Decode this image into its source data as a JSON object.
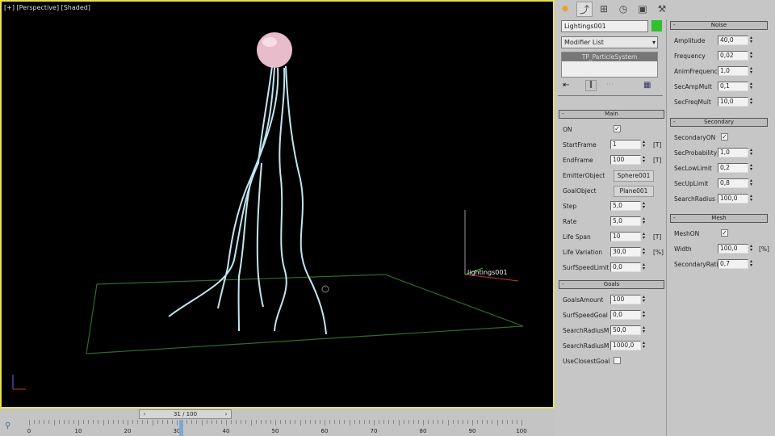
{
  "viewport": {
    "label": "[+] [Perspective] [Shaded]",
    "object_label": "lightings001"
  },
  "timeline": {
    "frame_display": "31 / 100",
    "current_frame": 31,
    "total_frames": 100,
    "labels": [
      "0",
      "10",
      "20",
      "30",
      "40",
      "50",
      "60",
      "70",
      "80",
      "90",
      "100"
    ]
  },
  "command_panel": {
    "tabs": [
      "create-icon",
      "modify-icon",
      "hierarchy-icon",
      "motion-icon",
      "display-icon",
      "utilities-icon"
    ],
    "object_name": "Lightings001",
    "object_color": "#2fbf2f",
    "modifier_list": "Modifier List",
    "stack_item": "TP_ParticleSystem"
  },
  "rollouts": {
    "main": {
      "title": "Main",
      "rows": [
        {
          "label": "ON",
          "type": "check",
          "checked": true
        },
        {
          "label": "StartFrame",
          "value": "1",
          "suffix": "[T]"
        },
        {
          "label": "EndFrame",
          "value": "100",
          "suffix": "[T]"
        },
        {
          "label": "EmitterObject",
          "type": "button",
          "value": "Sphere001"
        },
        {
          "label": "GoalObject",
          "type": "button",
          "value": "Plane001"
        },
        {
          "label": "Step",
          "value": "5,0"
        },
        {
          "label": "Rate",
          "value": "5,0"
        },
        {
          "label": "Life Span",
          "value": "10",
          "suffix": "[T]"
        },
        {
          "label": "Life Variation",
          "value": "30,0",
          "suffix": "[%]"
        },
        {
          "label": "SurfSpeedLimit",
          "value": "0,0"
        }
      ]
    },
    "goals": {
      "title": "Goals",
      "rows": [
        {
          "label": "GoalsAmount",
          "value": "100"
        },
        {
          "label": "SurfSpeedGoal",
          "value": "0,0"
        },
        {
          "label": "SearchRadiusM",
          "value": "50,0"
        },
        {
          "label": "SearchRadiusM",
          "value": "1000,0"
        },
        {
          "label": "UseClosestGoal",
          "type": "check",
          "checked": false
        }
      ]
    },
    "noise": {
      "title": "Noise",
      "rows": [
        {
          "label": "Amplitude",
          "value": "40,0"
        },
        {
          "label": "Frequency",
          "value": "0,02"
        },
        {
          "label": "AnimFrequency",
          "value": "1,0"
        },
        {
          "label": "SecAmpMult",
          "value": "0,1"
        },
        {
          "label": "SecFreqMult",
          "value": "10,0"
        }
      ]
    },
    "secondary": {
      "title": "Secondary",
      "rows": [
        {
          "label": "SecondaryON",
          "type": "check",
          "checked": true
        },
        {
          "label": "SecProbability",
          "value": "1,0"
        },
        {
          "label": "SecLowLimit",
          "value": "0,2"
        },
        {
          "label": "SecUpLimit",
          "value": "0,8"
        },
        {
          "label": "SearchRadius",
          "value": "100,0"
        }
      ]
    },
    "mesh": {
      "title": "Mesh",
      "rows": [
        {
          "label": "MeshON",
          "type": "check",
          "checked": true
        },
        {
          "label": "Width",
          "value": "100,0",
          "suffix": "[%]"
        },
        {
          "label": "SecondaryRatio",
          "value": "0,7"
        }
      ]
    }
  }
}
